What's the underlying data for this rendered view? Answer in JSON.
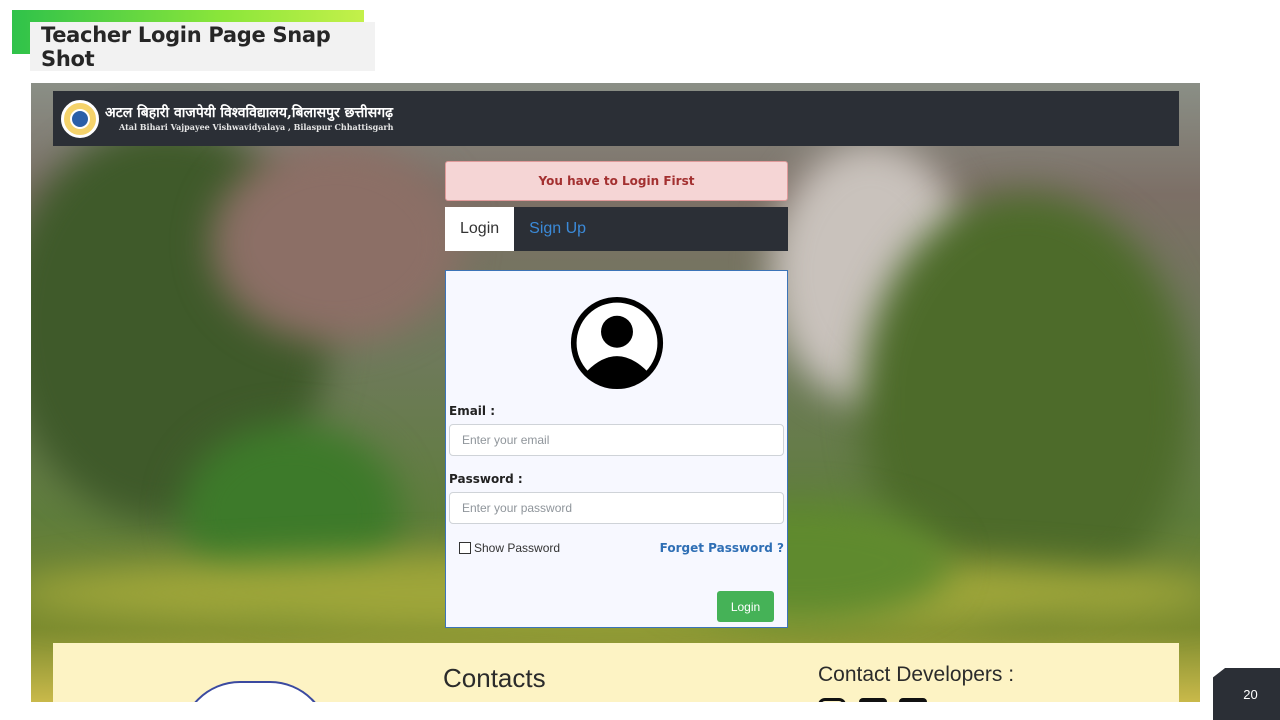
{
  "slide": {
    "title": "Teacher Login Page Snap Shot",
    "page_number": "20"
  },
  "app": {
    "header": {
      "university_hindi": "अटल बिहारी वाजपेयी विश्वविद्यालय,बिलासपुर छत्तीसगढ़",
      "university_english": "Atal Bihari Vajpayee Vishwavidyalaya , Bilaspur Chhattisgarh",
      "logo_icon": "university-emblem-icon"
    },
    "alert": {
      "message": "You have to Login First",
      "color": "#a33030"
    },
    "tabs": [
      {
        "label": "Login",
        "active": true
      },
      {
        "label": "Sign Up",
        "active": false
      }
    ],
    "form": {
      "avatar_icon": "user-avatar-icon",
      "email_label": "Email :",
      "email_placeholder": "Enter your email",
      "email_value": "",
      "password_label": "Password :",
      "password_placeholder": "Enter your password",
      "password_value": "",
      "show_password_label": "Show Password",
      "show_password_checked": false,
      "forget_password_label": "Forget Password ?",
      "login_button_label": "Login",
      "login_button_color": "#45b257"
    },
    "footer": {
      "contacts_title": "Contacts",
      "contact_developers_title": "Contact Developers :"
    }
  },
  "colors": {
    "header_bg": "#2b2f36",
    "link": "#3b8ad8",
    "title_accent": "#2fc24a"
  }
}
